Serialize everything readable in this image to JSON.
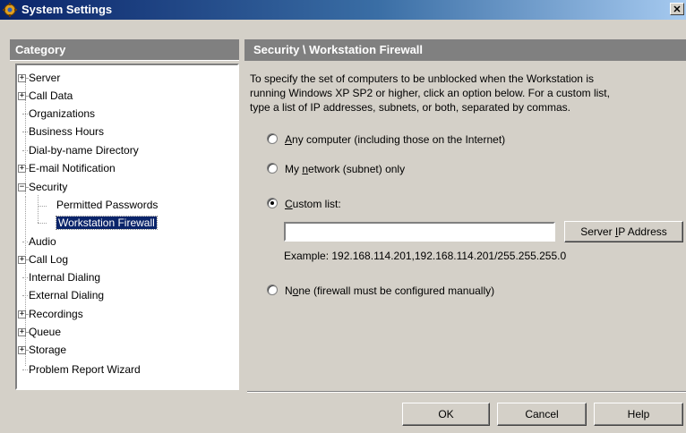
{
  "window": {
    "title": "System Settings",
    "close_glyph": "✕"
  },
  "category": {
    "header": "Category",
    "items": [
      {
        "label": "Server",
        "expander": "+"
      },
      {
        "label": "Call Data",
        "expander": "+"
      },
      {
        "label": "Organizations"
      },
      {
        "label": "Business Hours"
      },
      {
        "label": "Dial-by-name Directory"
      },
      {
        "label": "E-mail Notification",
        "expander": "+"
      },
      {
        "label": "Security",
        "expander": "−"
      },
      {
        "label": "Permitted Passwords"
      },
      {
        "label": "Workstation Firewall",
        "selected": true
      },
      {
        "label": "Audio"
      },
      {
        "label": "Call Log",
        "expander": "+"
      },
      {
        "label": "Internal Dialing"
      },
      {
        "label": "External Dialing"
      },
      {
        "label": "Recordings",
        "expander": "+"
      },
      {
        "label": "Queue",
        "expander": "+"
      },
      {
        "label": "Storage",
        "expander": "+"
      },
      {
        "label": "Problem Report Wizard"
      }
    ]
  },
  "section": {
    "header": "Security \\ Workstation Firewall",
    "description": [
      "To specify the set of computers to be unblocked when the Workstation is",
      "running Windows XP SP2 or higher, click an option below.  For a custom list,",
      "type a list of IP addresses, subnets, or both, separated by commas."
    ],
    "options": {
      "any": {
        "pre": "",
        "mnemonic": "A",
        "post": "ny computer (including those on the Internet)",
        "checked": false
      },
      "network": {
        "pre": "My ",
        "mnemonic": "n",
        "post": "etwork (subnet) only",
        "checked": false
      },
      "custom": {
        "pre": "",
        "mnemonic": "C",
        "post": "ustom list:",
        "checked": true
      },
      "none": {
        "pre": "N",
        "mnemonic": "o",
        "post": "ne (firewall must be configured manually)",
        "checked": false
      }
    },
    "ip_list_value": "",
    "server_ip_button": {
      "pre": "Server ",
      "mnemonic": "I",
      "post": "P Address"
    },
    "example": "Example: 192.168.114.201,192.168.114.201/255.255.255.0"
  },
  "buttons": {
    "ok": "OK",
    "cancel": "Cancel",
    "help": "Help"
  }
}
